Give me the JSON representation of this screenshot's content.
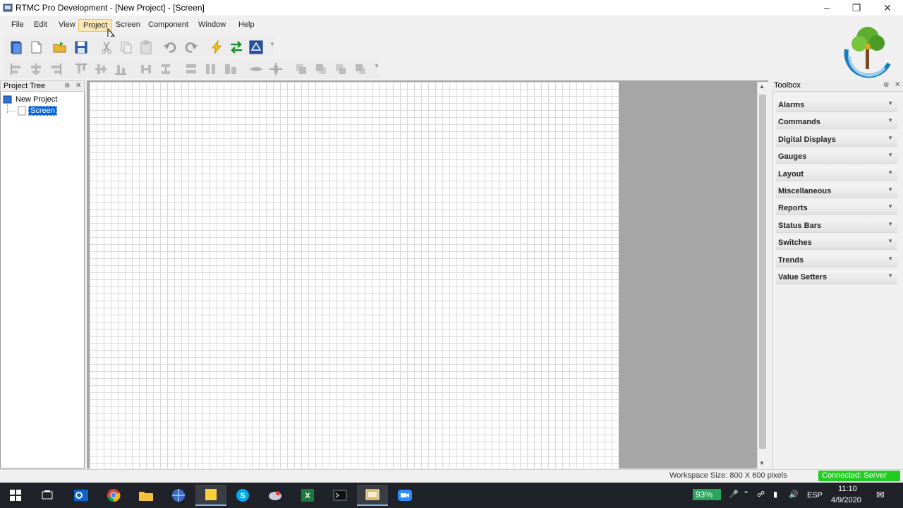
{
  "window": {
    "title": "RTMC Pro Development - [New Project] - [Screen]"
  },
  "menu": [
    {
      "label": "File"
    },
    {
      "label": "Edit"
    },
    {
      "label": "View"
    },
    {
      "label": "Project"
    },
    {
      "label": "Screen"
    },
    {
      "label": "Component"
    },
    {
      "label": "Window"
    },
    {
      "label": "Help"
    }
  ],
  "project_tree": {
    "title": "Project Tree",
    "root": "New Project",
    "child": "Screen"
  },
  "toolbox": {
    "title": "Toolbox",
    "categories": [
      "Alarms",
      "Commands",
      "Digital Displays",
      "Gauges",
      "Layout",
      "Miscellaneous",
      "Reports",
      "Status Bars",
      "Switches",
      "Trends",
      "Value Setters"
    ]
  },
  "status": {
    "workspace_size": "Workspace Size: 800 X 600 pixels",
    "connection": "Connected: Server"
  },
  "tray": {
    "battery": "93%",
    "language": "ESP",
    "time": "11:10",
    "date": "4/9/2020"
  },
  "colors": {
    "connected": "#22cc22",
    "menu_active": "#fbe7b5",
    "taskbar": "#1f2229"
  }
}
